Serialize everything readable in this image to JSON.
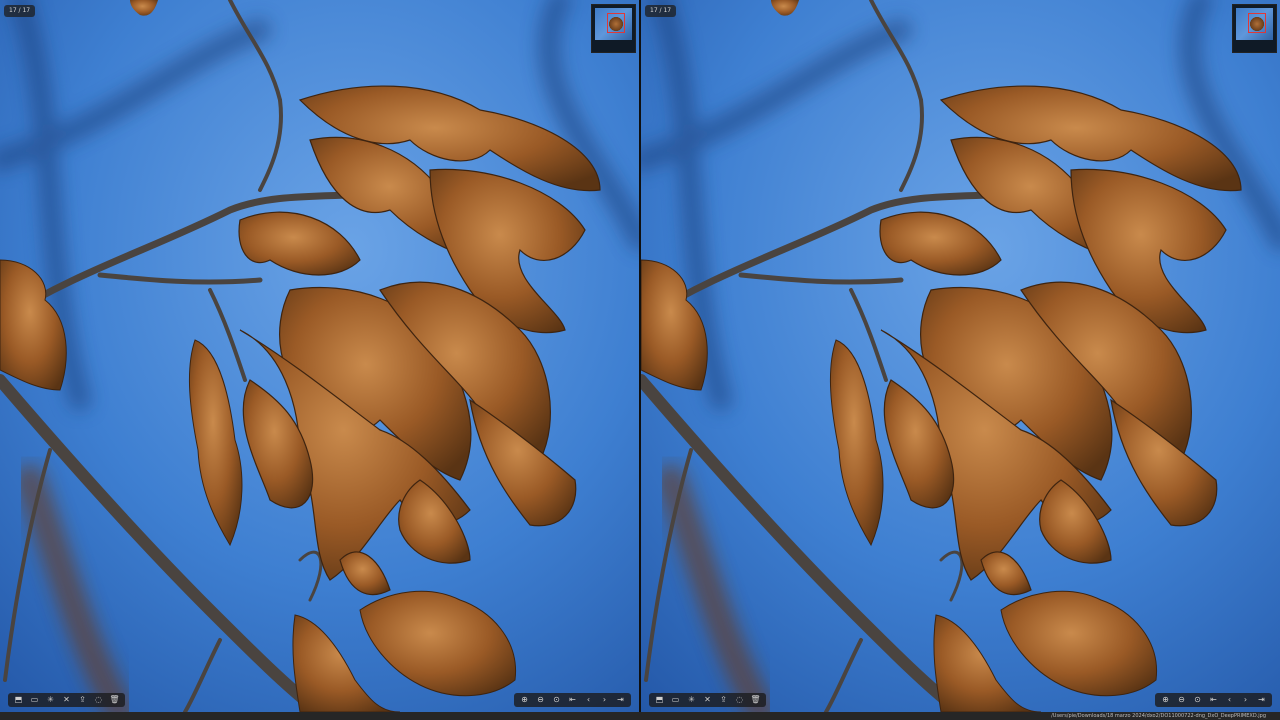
{
  "colors": {
    "sky_light": "#6aa3e6",
    "sky_mid": "#3e7fd1",
    "sky_dark": "#2458a8",
    "leaf_light": "#c98a4c",
    "leaf_mid": "#9a5a26",
    "leaf_dark": "#5a3414",
    "branch": "#4a4440"
  },
  "panes": [
    {
      "counter": "17 / 17",
      "thumbnail_icon": "thumbnail-navigator-icon",
      "left_tools": [
        {
          "name": "import-icon",
          "glyph": "⬒"
        },
        {
          "name": "folder-icon",
          "glyph": "▭"
        },
        {
          "name": "sparkle-icon",
          "glyph": "✳"
        },
        {
          "name": "close-icon",
          "glyph": "✕"
        },
        {
          "name": "share-icon",
          "glyph": "⇪"
        },
        {
          "name": "shield-icon",
          "glyph": "◌"
        },
        {
          "name": "trash-icon",
          "glyph": "🗑"
        }
      ],
      "right_tools": [
        {
          "name": "zoom-in-icon",
          "glyph": "⊕"
        },
        {
          "name": "zoom-out-icon",
          "glyph": "⊖"
        },
        {
          "name": "fit-icon",
          "glyph": "⊙"
        },
        {
          "name": "first-icon",
          "glyph": "⇤"
        },
        {
          "name": "previous-icon",
          "glyph": "‹"
        },
        {
          "name": "next-icon",
          "glyph": "›"
        },
        {
          "name": "last-icon",
          "glyph": "⇥"
        }
      ]
    },
    {
      "counter": "17 / 17",
      "thumbnail_icon": "thumbnail-navigator-icon",
      "left_tools": [
        {
          "name": "import-icon",
          "glyph": "⬒"
        },
        {
          "name": "folder-icon",
          "glyph": "▭"
        },
        {
          "name": "sparkle-icon",
          "glyph": "✳"
        },
        {
          "name": "close-icon",
          "glyph": "✕"
        },
        {
          "name": "share-icon",
          "glyph": "⇪"
        },
        {
          "name": "shield-icon",
          "glyph": "◌"
        },
        {
          "name": "trash-icon",
          "glyph": "🗑"
        }
      ],
      "right_tools": [
        {
          "name": "zoom-in-icon",
          "glyph": "⊕"
        },
        {
          "name": "zoom-out-icon",
          "glyph": "⊖"
        },
        {
          "name": "fit-icon",
          "glyph": "⊙"
        },
        {
          "name": "first-icon",
          "glyph": "⇤"
        },
        {
          "name": "previous-icon",
          "glyph": "‹"
        },
        {
          "name": "next-icon",
          "glyph": "›"
        },
        {
          "name": "last-icon",
          "glyph": "⇥"
        }
      ]
    }
  ],
  "statusbar": {
    "path": "/Users/pie/Downloads/18 marzo 2024/dxo2/DO11000722-dng_DxO_DeepPRIMEXD.jpg"
  }
}
